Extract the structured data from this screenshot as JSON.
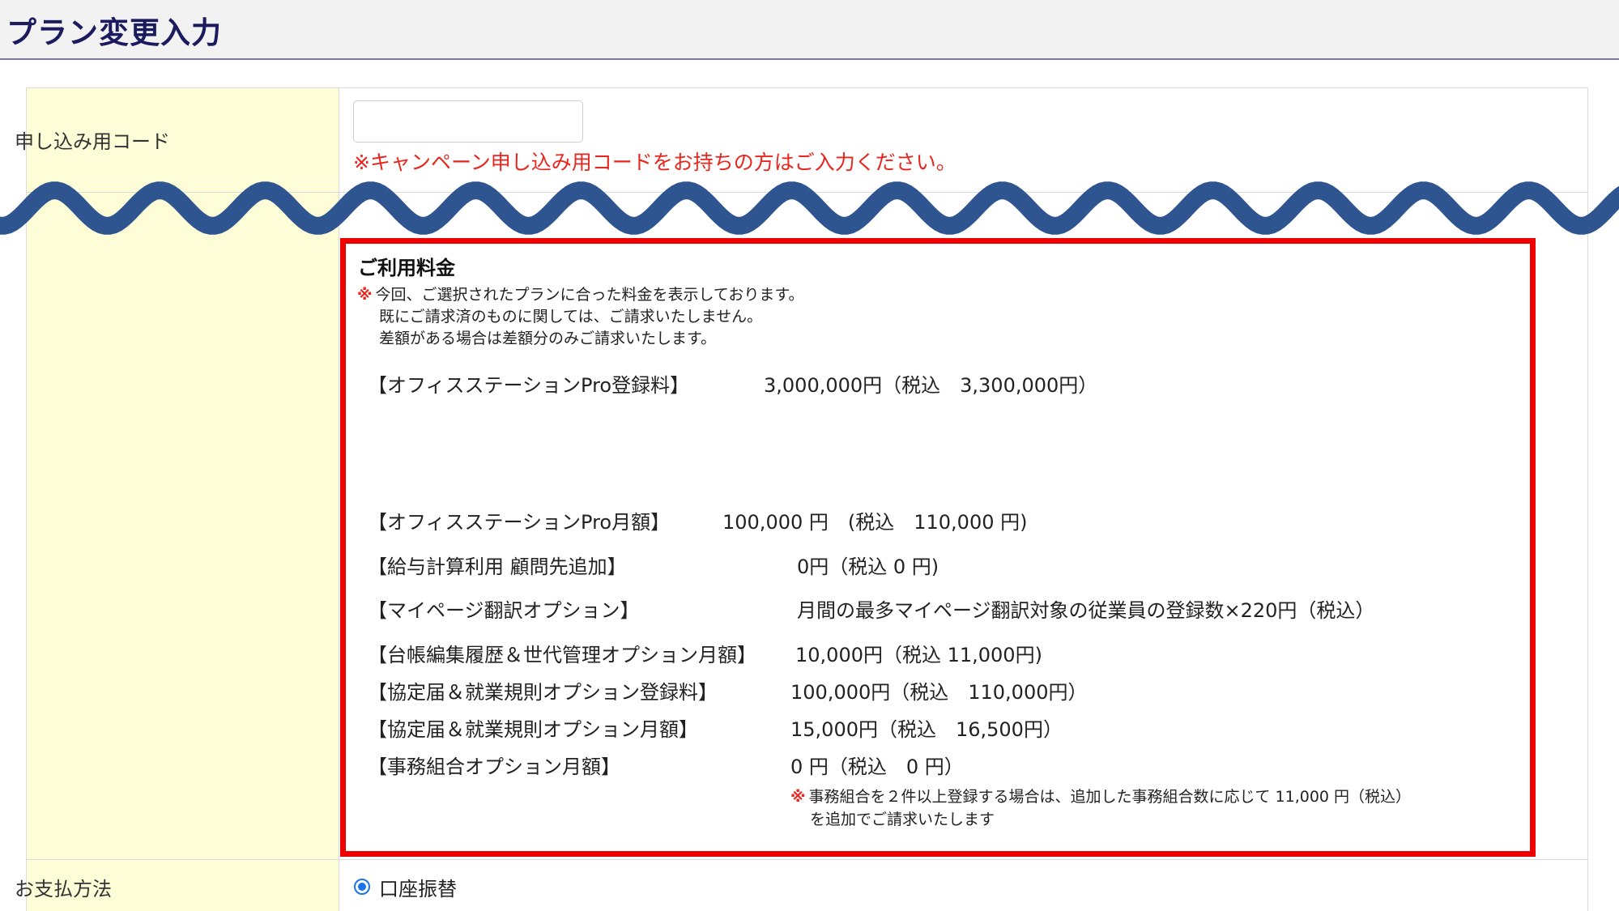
{
  "page_title": "プラン変更入力",
  "campaign": {
    "label": "申し込み用コード",
    "input_value": "",
    "note": "※キャンペーン申し込み用コードをお持ちの方はご入力ください。"
  },
  "fees": {
    "title": "ご利用料金",
    "mark": "※",
    "notes": [
      "今回、ご選択されたプランに合った料金を表示しております。",
      "既にご請求済のものに関しては、ご請求いたしません。",
      "差額がある場合は差額分のみご請求いたします。"
    ],
    "items": [
      {
        "name": "【オフィスステーションPro登録料】",
        "value": "3,000,000円（税込　3,300,000円）"
      },
      {
        "name": "【オフィスステーションPro月額】",
        "value": "100,000 円　(税込　110,000 円)"
      },
      {
        "name": "【給与計算利用 顧問先追加】",
        "value": "0円（税込 0 円)"
      },
      {
        "name": "【マイページ翻訳オプション】",
        "value": "月間の最多マイページ翻訳対象の従業員の登録数×220円（税込）"
      },
      {
        "name": "【台帳編集履歴＆世代管理オプション月額】",
        "value": "10,000円（税込 11,000円)"
      },
      {
        "name": "【協定届＆就業規則オプション登録料】",
        "value": "100,000円（税込　110,000円）"
      },
      {
        "name": "【協定届＆就業規則オプション月額】",
        "value": "15,000円（税込　16,500円）"
      },
      {
        "name": "【事務組合オプション月額】",
        "value": "0 円（税込　0 円）"
      }
    ],
    "union_note_line1": "事務組合を２件以上登録する場合は、追加した事務組合数に応じて 11,000 円（税込）",
    "union_note_line2": "を追加でご請求いたします"
  },
  "payment": {
    "label": "お支払方法",
    "selected_option": "口座振替"
  },
  "colors": {
    "header_title": "#1b1b5e",
    "label_bg": "#fdfdd8",
    "note_red": "#e8261e",
    "highlight_border": "#ee0000",
    "wave": "#2f5590",
    "radio": "#1a73e8"
  }
}
